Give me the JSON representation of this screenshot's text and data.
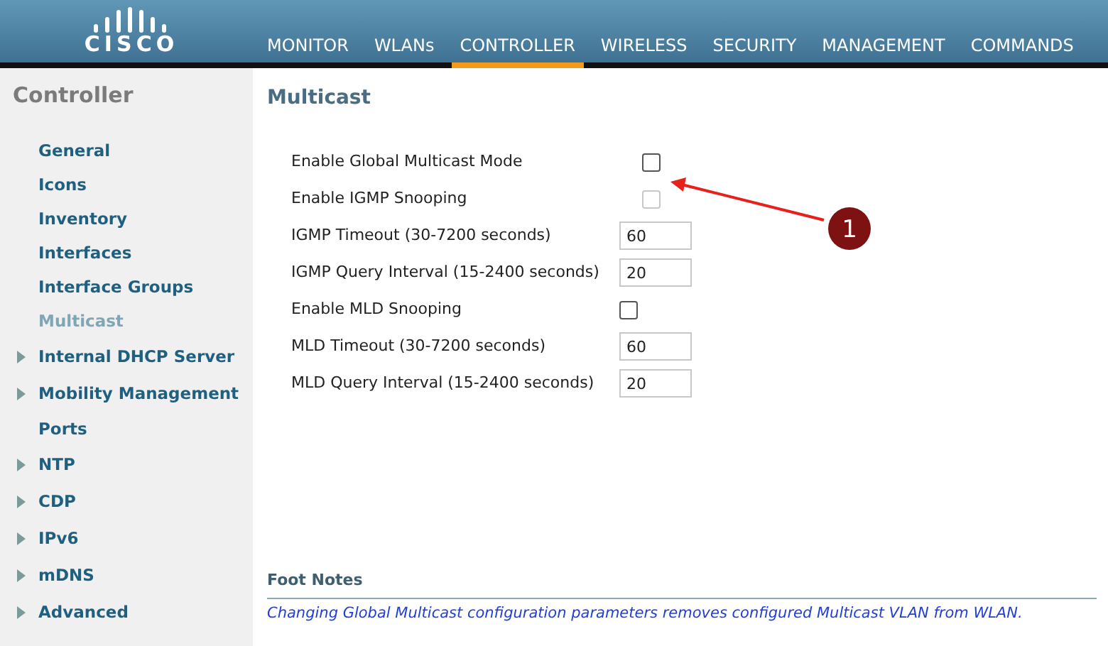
{
  "header": {
    "logo": "CISCO",
    "nav": [
      {
        "label": "MONITOR",
        "selected": false
      },
      {
        "label": "WLANs",
        "selected": false
      },
      {
        "label": "CONTROLLER",
        "selected": true
      },
      {
        "label": "WIRELESS",
        "selected": false
      },
      {
        "label": "SECURITY",
        "selected": false
      },
      {
        "label": "MANAGEMENT",
        "selected": false
      },
      {
        "label": "COMMANDS",
        "selected": false
      }
    ]
  },
  "sidebar": {
    "title": "Controller",
    "items": [
      {
        "label": "General",
        "expandable": false,
        "selected": false
      },
      {
        "label": "Icons",
        "expandable": false,
        "selected": false
      },
      {
        "label": "Inventory",
        "expandable": false,
        "selected": false
      },
      {
        "label": "Interfaces",
        "expandable": false,
        "selected": false
      },
      {
        "label": "Interface Groups",
        "expandable": false,
        "selected": false
      },
      {
        "label": "Multicast",
        "expandable": false,
        "selected": true
      },
      {
        "label": "Internal DHCP Server",
        "expandable": true,
        "selected": false
      },
      {
        "label": "Mobility Management",
        "expandable": true,
        "selected": false
      },
      {
        "label": "Ports",
        "expandable": false,
        "selected": false
      },
      {
        "label": "NTP",
        "expandable": true,
        "selected": false
      },
      {
        "label": "CDP",
        "expandable": true,
        "selected": false
      },
      {
        "label": "IPv6",
        "expandable": true,
        "selected": false
      },
      {
        "label": "mDNS",
        "expandable": true,
        "selected": false
      },
      {
        "label": "Advanced",
        "expandable": true,
        "selected": false
      }
    ]
  },
  "content": {
    "title": "Multicast",
    "fields": [
      {
        "kind": "checkbox",
        "label": "Enable Global Multicast Mode",
        "checked": false,
        "disabled": false
      },
      {
        "kind": "checkbox",
        "label": "Enable IGMP Snooping",
        "checked": false,
        "disabled": true
      },
      {
        "kind": "text",
        "label": "IGMP Timeout (30-7200 seconds)",
        "value": "60"
      },
      {
        "kind": "text",
        "label": "IGMP Query Interval (15-2400 seconds)",
        "value": "20"
      },
      {
        "kind": "checkbox",
        "label": "Enable MLD Snooping",
        "checked": false,
        "disabled": false
      },
      {
        "kind": "text",
        "label": "MLD Timeout (30-7200 seconds)",
        "value": "60"
      },
      {
        "kind": "text",
        "label": "MLD Query Interval (15-2400 seconds)",
        "value": "20"
      }
    ],
    "callout": {
      "number": "1"
    },
    "footnotes": {
      "title": "Foot Notes",
      "text": "Changing Global Multicast configuration parameters removes configured Multicast VLAN from WLAN."
    }
  }
}
